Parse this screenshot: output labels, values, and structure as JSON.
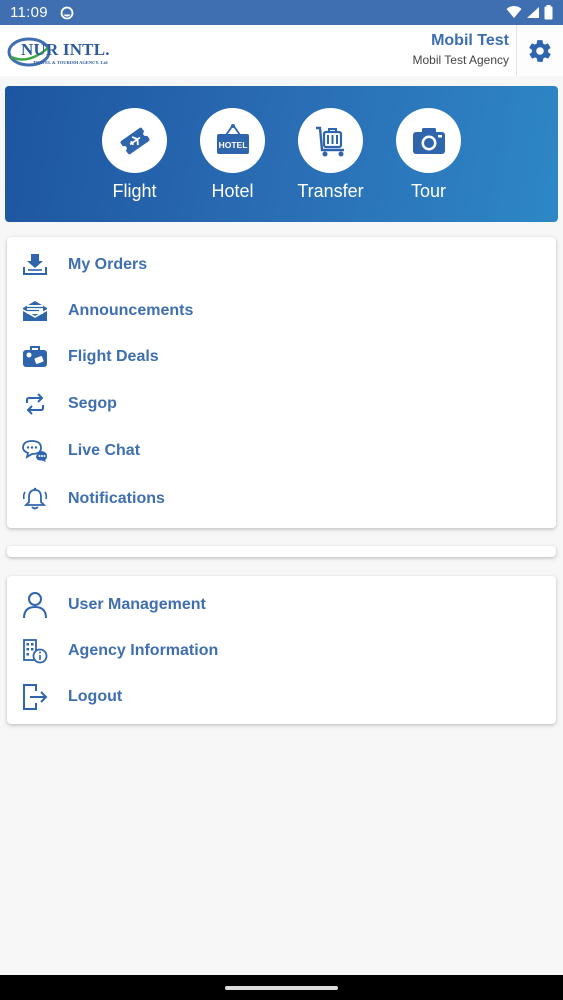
{
  "status_bar": {
    "time": "11:09"
  },
  "header": {
    "logo_text": "NUR INTL.",
    "logo_subtitle": "TRAVEL & TOURISM AGENCY. Ltd",
    "user_name": "Mobil Test",
    "agency_name": "Mobil Test Agency"
  },
  "services": [
    {
      "label": "Flight",
      "icon": "flight-ticket-icon"
    },
    {
      "label": "Hotel",
      "icon": "hotel-sign-icon"
    },
    {
      "label": "Transfer",
      "icon": "luggage-cart-icon"
    },
    {
      "label": "Tour",
      "icon": "camera-icon"
    }
  ],
  "menu_primary": [
    {
      "label": "My Orders",
      "icon": "download-tray-icon"
    },
    {
      "label": "Announcements",
      "icon": "envelope-icon"
    },
    {
      "label": "Flight Deals",
      "icon": "suitcase-icon"
    },
    {
      "label": "Segop",
      "icon": "repeat-arrows-icon"
    },
    {
      "label": "Live Chat",
      "icon": "chat-bubbles-icon"
    },
    {
      "label": "Notifications",
      "icon": "bell-icon"
    }
  ],
  "menu_account": [
    {
      "label": "User Management",
      "icon": "user-icon"
    },
    {
      "label": "Agency Information",
      "icon": "building-info-icon"
    },
    {
      "label": "Logout",
      "icon": "logout-icon"
    }
  ],
  "colors": {
    "status_bar": "#3f6fb0",
    "accent": "#3f6fb0",
    "hero_gradient_start": "#1d55a0",
    "hero_gradient_end": "#2d87c6"
  }
}
